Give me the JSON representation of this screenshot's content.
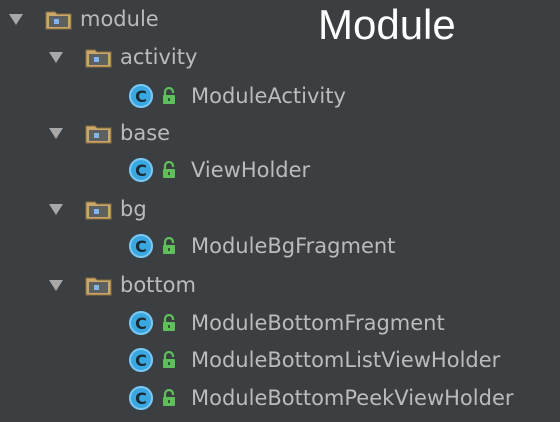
{
  "title": "Module",
  "tree": {
    "root": {
      "label": "module",
      "icon": "folder-icon"
    },
    "activity": {
      "label": "activity",
      "icon": "folder-icon"
    },
    "activity_items": [
      "ModuleActivity"
    ],
    "base": {
      "label": "base",
      "icon": "folder-icon"
    },
    "base_items": [
      "ViewHolder"
    ],
    "bg": {
      "label": "bg",
      "icon": "folder-icon"
    },
    "bg_items": [
      "ModuleBgFragment"
    ],
    "bottom": {
      "label": "bottom",
      "icon": "folder-icon"
    },
    "bottom_items": [
      "ModuleBottomFragment",
      "ModuleBottomListViewHolder",
      "ModuleBottomPeekViewHolder"
    ],
    "class_badge": "C"
  },
  "colors": {
    "background": "#3c3f41",
    "text": "#bbbbbb",
    "folder": "#c9a86a",
    "class_icon": "#3aa8e0",
    "lock": "#5fbf5a"
  }
}
